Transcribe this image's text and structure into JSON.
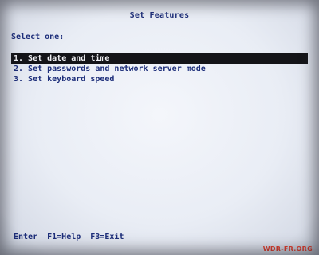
{
  "screen": {
    "title": "Set Features",
    "prompt": "Select one:"
  },
  "menu": {
    "items": [
      {
        "label": "1. Set date and time",
        "selected": true
      },
      {
        "label": "2. Set passwords and network server mode",
        "selected": false
      },
      {
        "label": "3. Set keyboard speed",
        "selected": false
      }
    ]
  },
  "footer": {
    "enter": "Enter",
    "help": "F1=Help",
    "exit": "F3=Exit"
  },
  "watermark": "WDR-FR.ORG",
  "colors": {
    "text": "#1d2e7a",
    "highlight_bg": "#141418",
    "highlight_fg": "#f2f2f6",
    "background": "#eceff6",
    "watermark": "#e23a2a"
  }
}
